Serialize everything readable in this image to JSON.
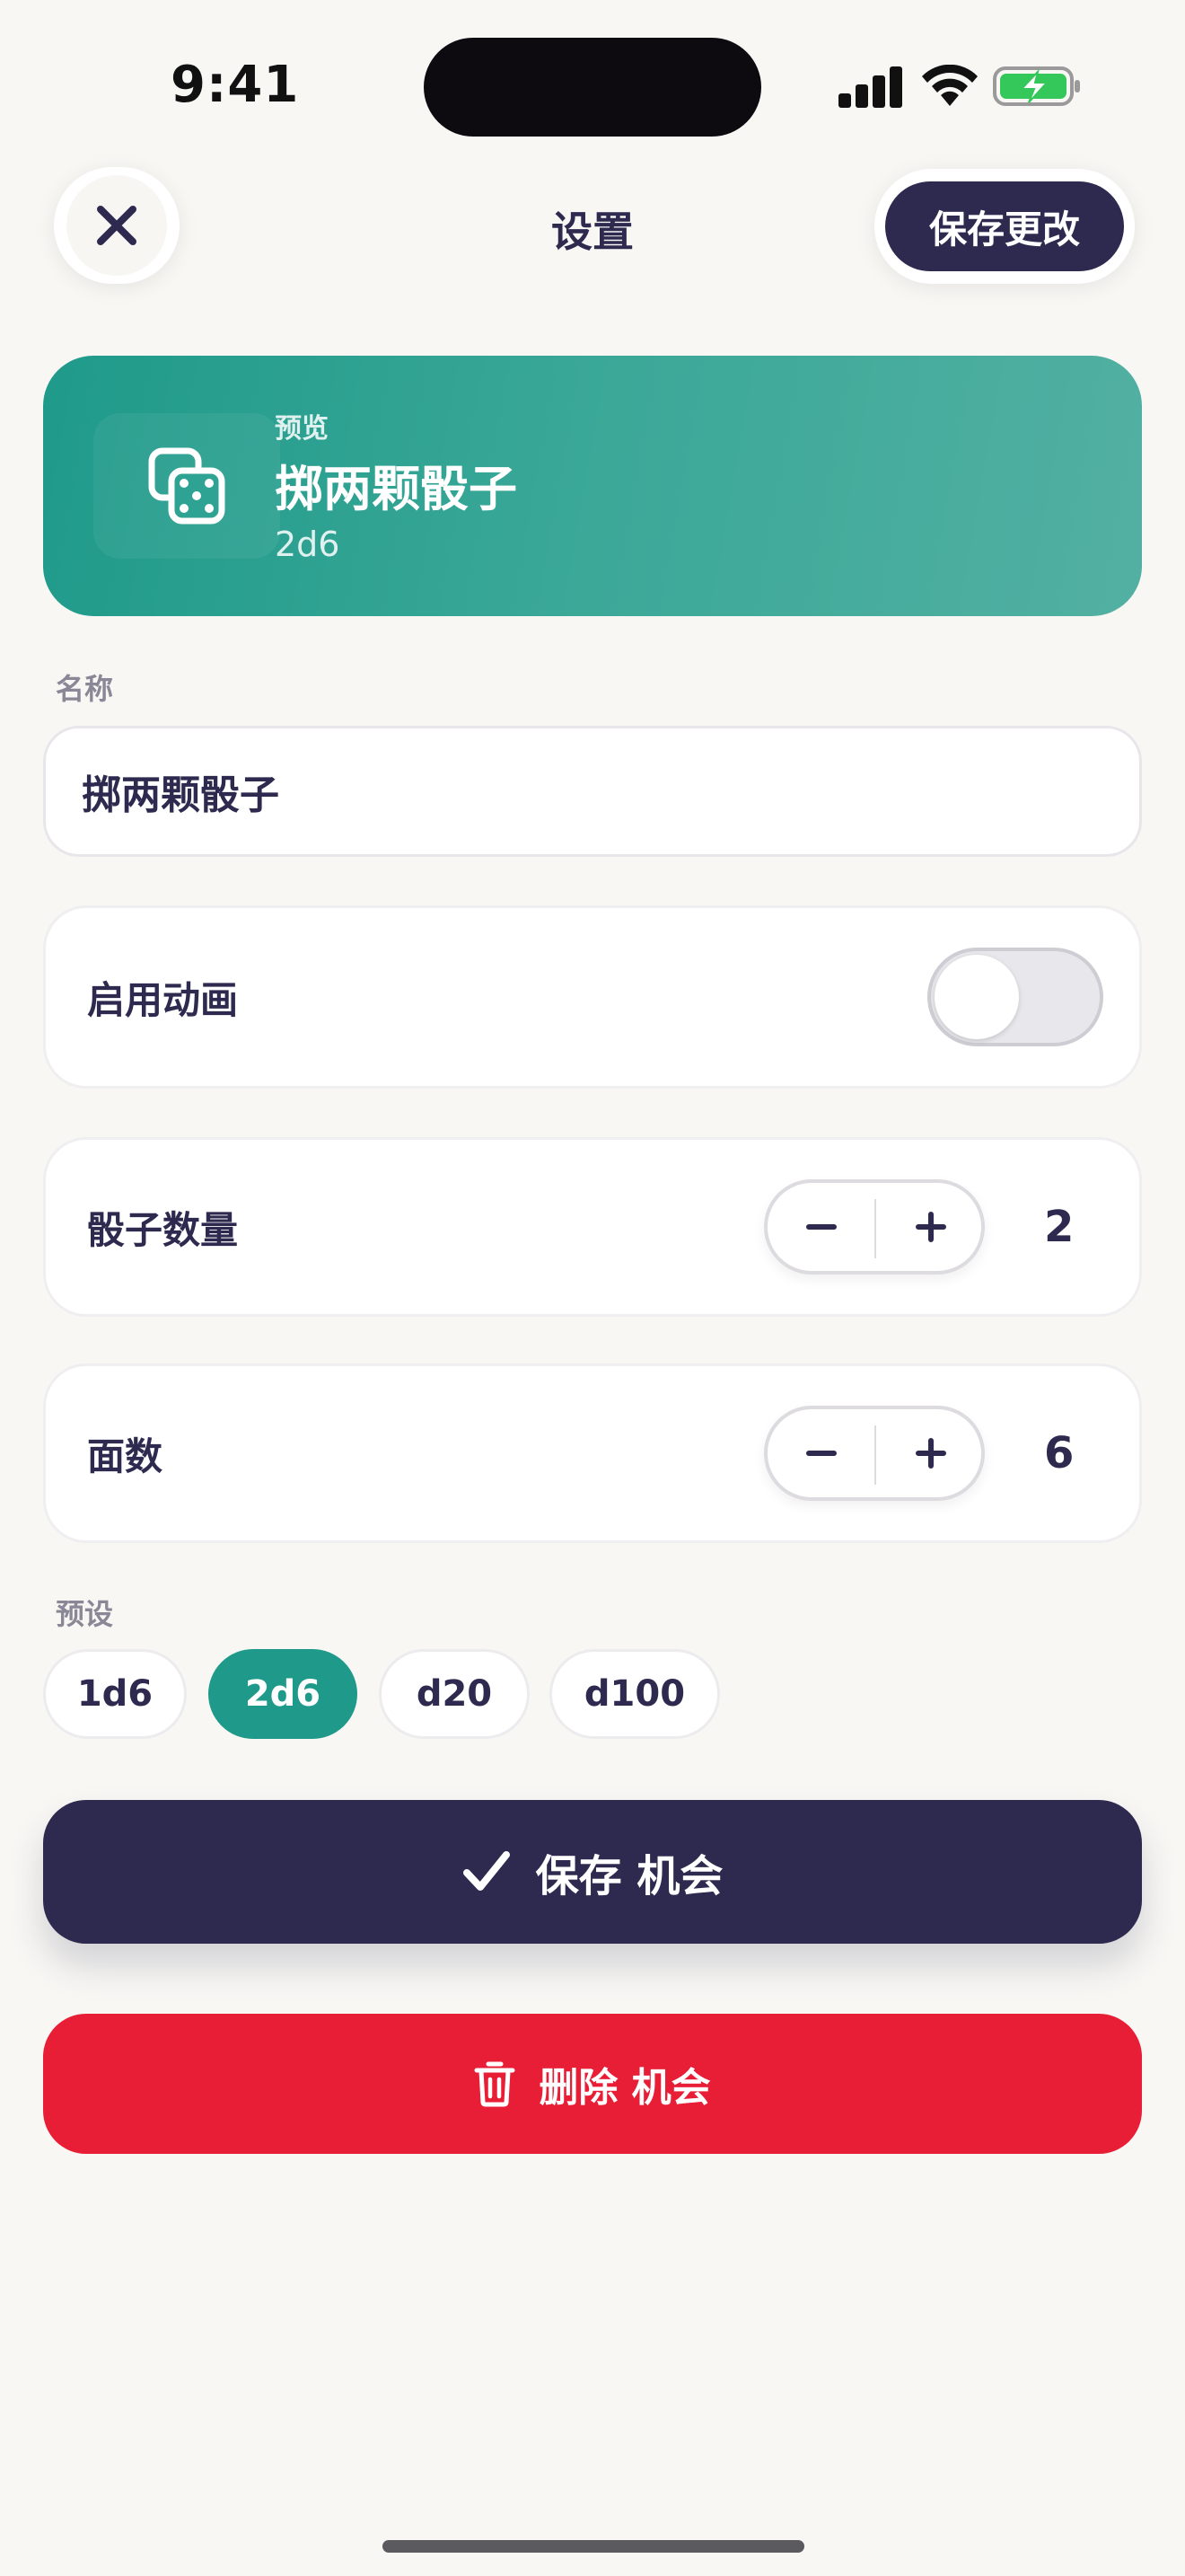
{
  "status_bar": {
    "time": "9:41"
  },
  "header": {
    "title": "设置",
    "close_icon": "close-icon",
    "save_changes_label": "保存更改"
  },
  "preview": {
    "label": "预览",
    "title": "掷两颗骰子",
    "subtitle": "2d6",
    "icon": "dice-icon"
  },
  "name_field": {
    "label": "名称",
    "value": "掷两颗骰子"
  },
  "animation": {
    "label": "启用动画",
    "enabled": false
  },
  "dice_count": {
    "label": "骰子数量",
    "value": "2"
  },
  "faces": {
    "label": "面数",
    "value": "6"
  },
  "presets": {
    "label": "预设",
    "items": [
      {
        "label": "1d6",
        "active": false
      },
      {
        "label": "2d6",
        "active": true
      },
      {
        "label": "d20",
        "active": false
      },
      {
        "label": "d100",
        "active": false
      }
    ]
  },
  "actions": {
    "save_label": "保存 机会",
    "delete_label": "删除 机会"
  },
  "colors": {
    "primary": "#2e2a4f",
    "accent": "#1f9a8a",
    "danger": "#e81e36",
    "background": "#f8f7f4"
  }
}
